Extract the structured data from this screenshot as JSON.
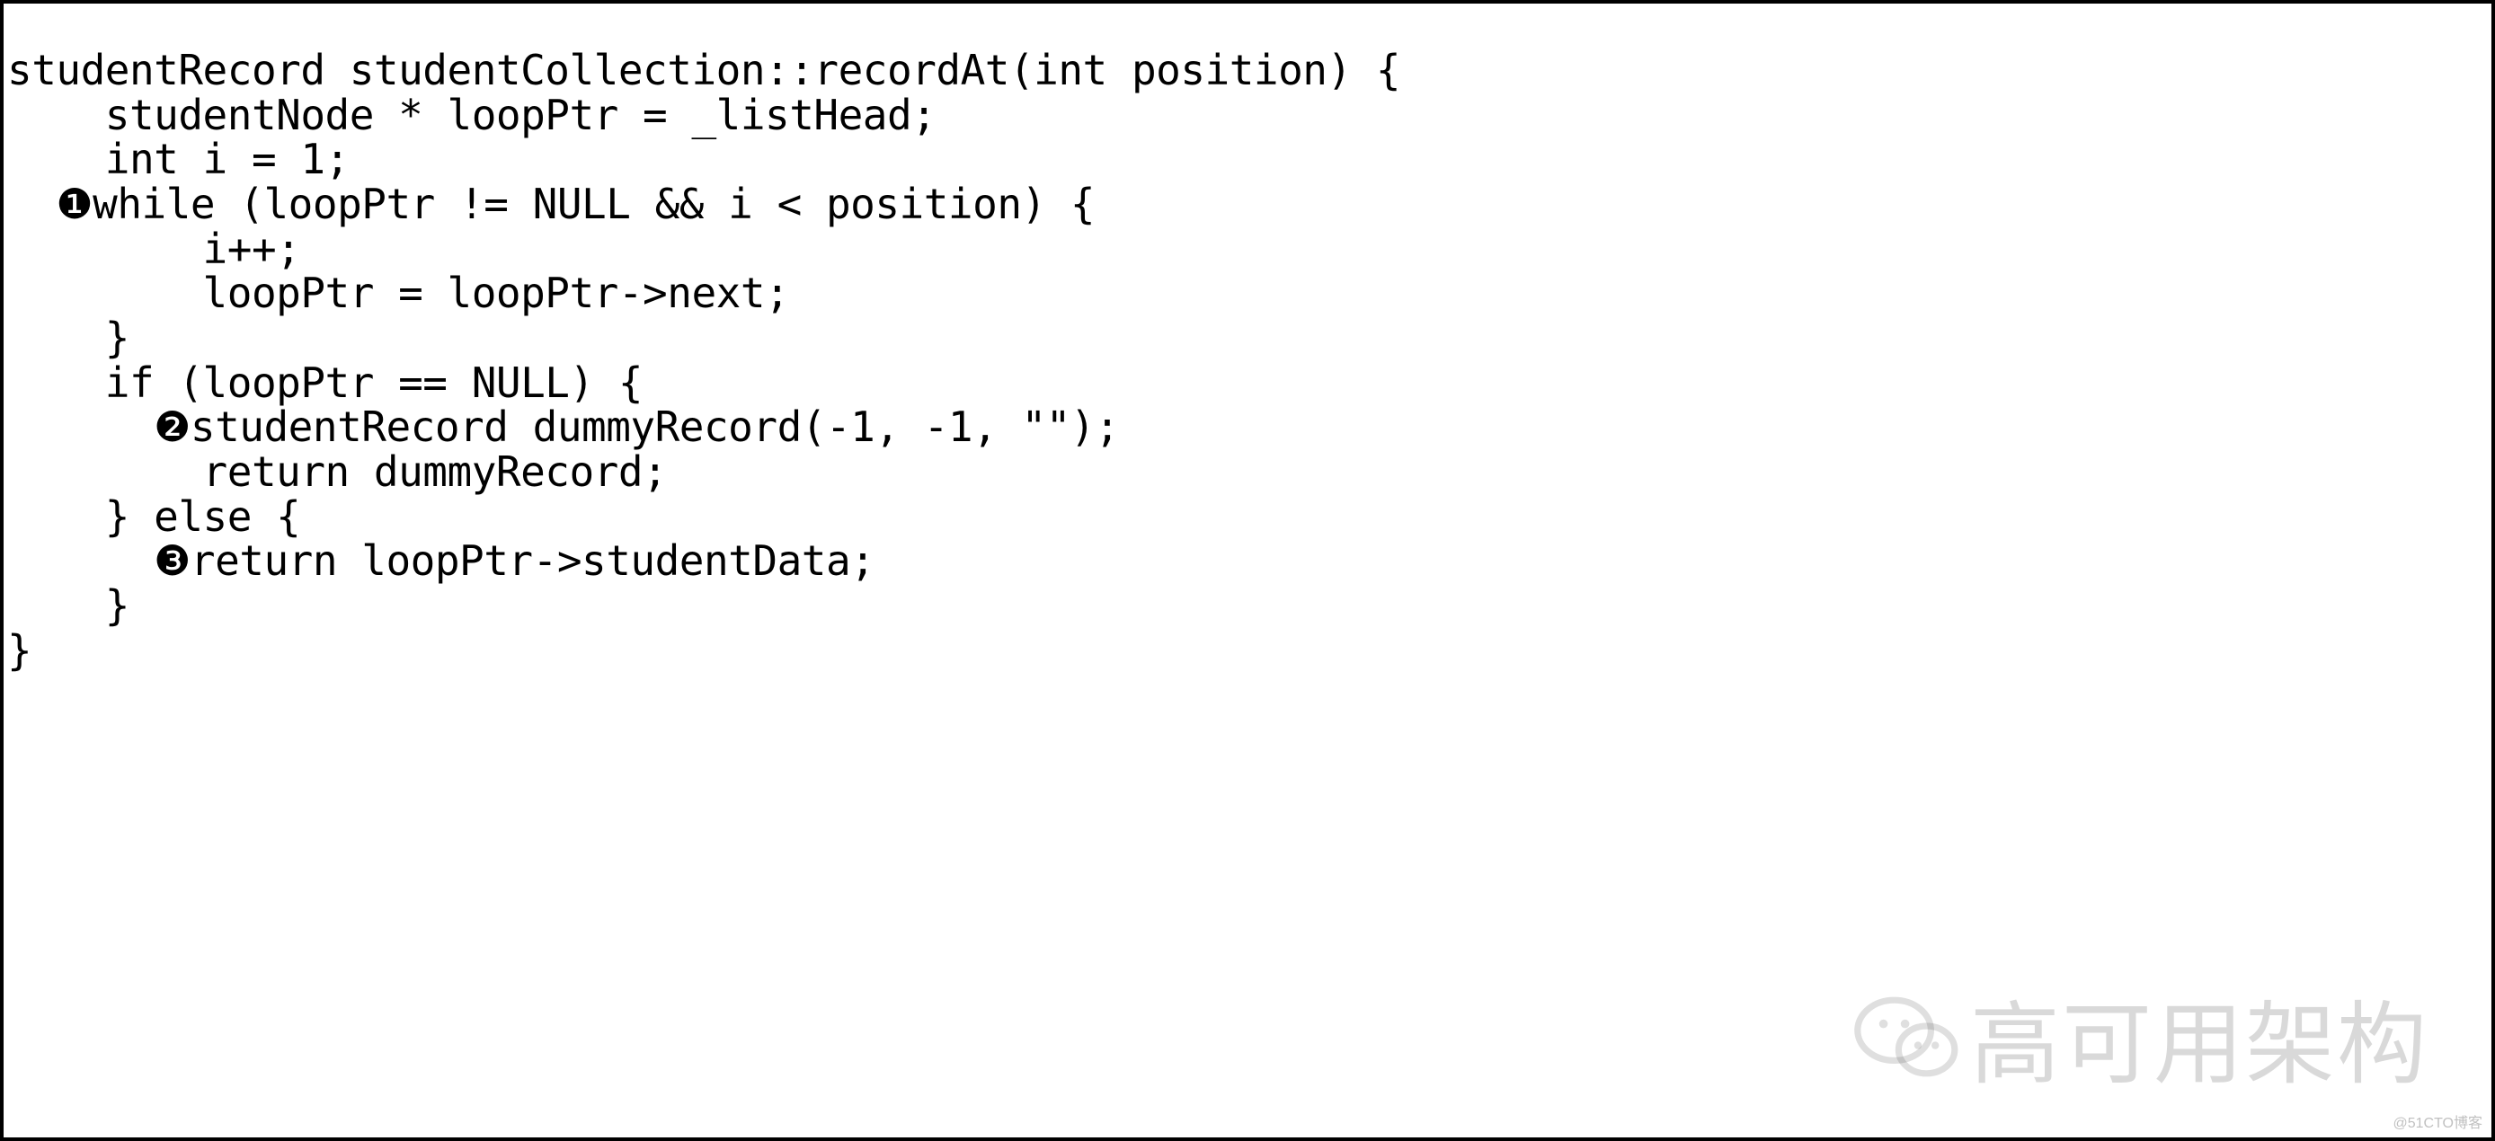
{
  "code": {
    "lines": [
      "studentRecord studentCollection::recordAt(int position) {",
      "    studentNode * loopPtr = _listHead;",
      "    int i = 1;",
      "  ❶while (loopPtr != NULL && i < position) {",
      "        i++;",
      "        loopPtr = loopPtr->next;",
      "    }",
      "    if (loopPtr == NULL) {",
      "      ❷studentRecord dummyRecord(-1, -1, \"\");",
      "        return dummyRecord;",
      "    } else {",
      "      ❸return loopPtr->studentData;",
      "    }",
      "}"
    ]
  },
  "watermark": {
    "main": "高可用架构",
    "corner": "@51CTO博客"
  }
}
